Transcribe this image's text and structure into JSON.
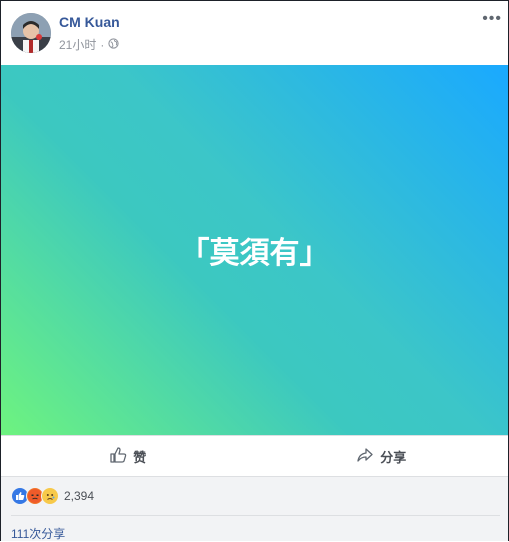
{
  "post": {
    "author": "CM Kuan",
    "time": "21小时",
    "separator": "·",
    "more_label": "•••",
    "text": "「莫須有」",
    "colors": {
      "gradient_start": "#1aa9ff",
      "gradient_end": "#6ef37f",
      "text": "#ffffff"
    }
  },
  "actions": {
    "like": "赞",
    "share": "分享"
  },
  "engagement": {
    "reaction_count": "2,394",
    "reactions": [
      "like-reaction",
      "angry-reaction",
      "sad-reaction"
    ],
    "shares": "111次分享"
  }
}
